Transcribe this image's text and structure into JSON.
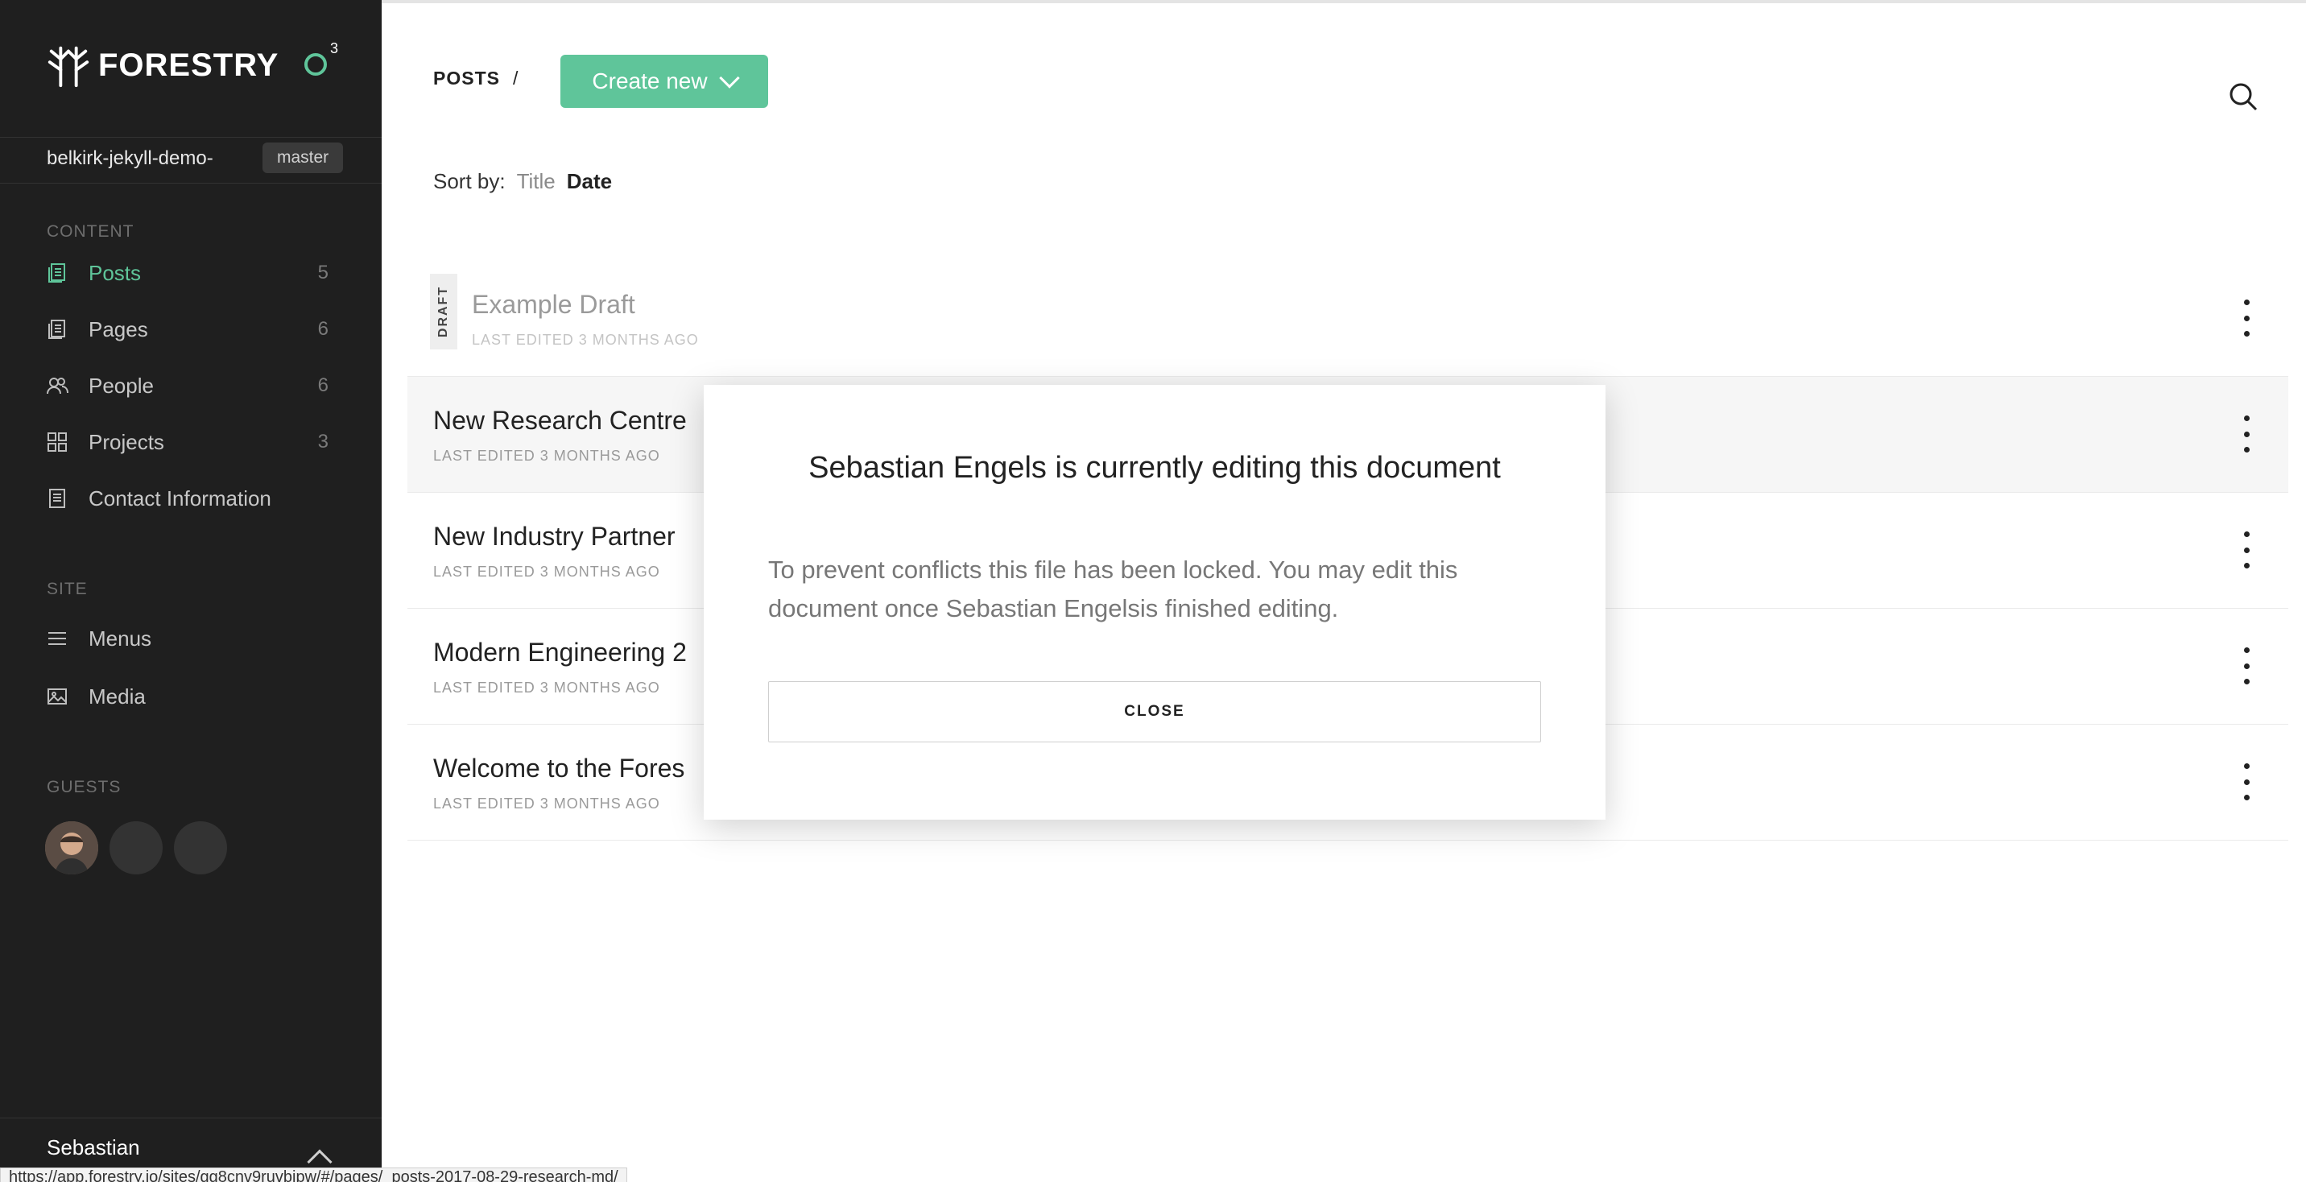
{
  "brand": {
    "name": "FORESTRY",
    "accent": "#5fc59a"
  },
  "notifications": {
    "count": "3"
  },
  "site": {
    "name": "belkirk-jekyll-demo-",
    "branch": "master"
  },
  "sidebar": {
    "content_label": "CONTENT",
    "content_items": [
      {
        "label": "Posts",
        "count": "5",
        "icon": "document-stack-icon"
      },
      {
        "label": "Pages",
        "count": "6",
        "icon": "document-stack-icon"
      },
      {
        "label": "People",
        "count": "6",
        "icon": "people-icon"
      },
      {
        "label": "Projects",
        "count": "3",
        "icon": "grid-icon"
      },
      {
        "label": "Contact Information",
        "count": "",
        "icon": "document-icon"
      }
    ],
    "site_label": "SITE",
    "site_items": [
      {
        "label": "Menus",
        "icon": "hamburger-icon"
      },
      {
        "label": "Media",
        "icon": "image-icon"
      }
    ],
    "guests_label": "GUESTS",
    "user_name": "Sebastian"
  },
  "header": {
    "breadcrumb": "POSTS",
    "separator": "/",
    "create_label": "Create new"
  },
  "sort": {
    "label": "Sort by:",
    "title": "Title",
    "date": "Date"
  },
  "documents": [
    {
      "title": "Example Draft",
      "meta": "LAST EDITED 3 MONTHS AGO",
      "draft": "DRAFT"
    },
    {
      "title": "New Research Centre",
      "meta": "LAST EDITED 3 MONTHS AGO"
    },
    {
      "title": "New Industry Partner",
      "meta": "LAST EDITED 3 MONTHS AGO"
    },
    {
      "title": "Modern Engineering 2",
      "meta": "LAST EDITED 3 MONTHS AGO"
    },
    {
      "title": "Welcome to the Fores",
      "meta": "LAST EDITED 3 MONTHS AGO"
    }
  ],
  "modal": {
    "title": "Sebastian Engels is currently editing this document",
    "body": "To prevent conflicts this file has been locked. You may edit this document once Sebastian Engelsis finished editing.",
    "close_label": "CLOSE"
  },
  "status_url": "https://app.forestry.io/sites/gg8cnv9ruvbipw/#/pages/_posts-2017-08-29-research-md/"
}
